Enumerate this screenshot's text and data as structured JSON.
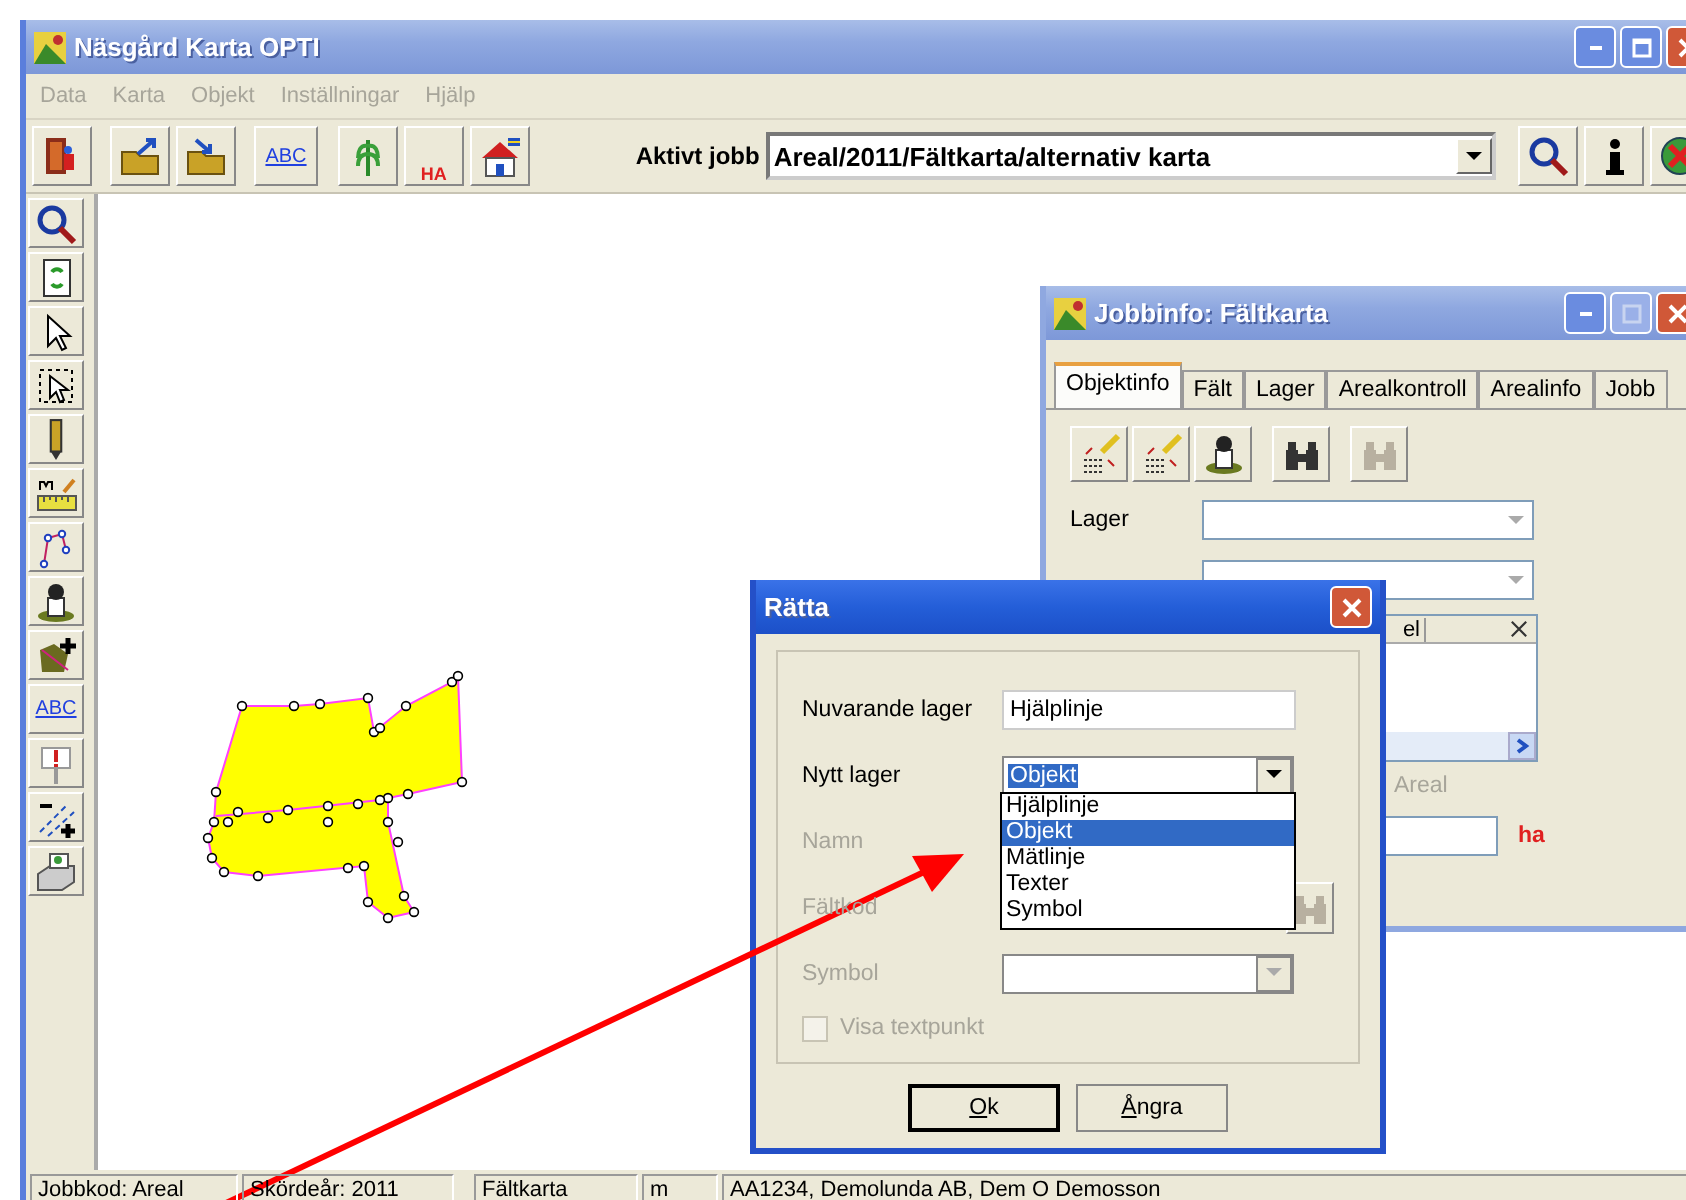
{
  "window": {
    "title": "Näsgård Karta OPTI"
  },
  "menu": [
    "Data",
    "Karta",
    "Objekt",
    "Inställningar",
    "Hjälp"
  ],
  "toolbar": {
    "abc_label": "ABC",
    "ha_label": "HA",
    "active_job_label": "Aktivt jobb",
    "active_job": "Areal/2011/Fältkarta/alternativ karta"
  },
  "side_toolbar": {
    "abc_label": "ABC"
  },
  "jobbinfo": {
    "title": "Jobbinfo: Fältkarta",
    "tabs": [
      {
        "label": "Objektinfo",
        "selected": true
      },
      {
        "label": "Fält",
        "selected": false
      },
      {
        "label": "Lager",
        "selected": false
      },
      {
        "label": "Arealkontroll",
        "selected": false
      },
      {
        "label": "Arealinfo",
        "selected": false
      },
      {
        "label": "Jobb",
        "selected": false
      }
    ],
    "lager_label": "Lager",
    "column_header": "el",
    "areal_label": "Areal",
    "unit": "ha"
  },
  "ratta": {
    "title": "Rätta",
    "fields": [
      {
        "label": "Nuvarande lager",
        "kind": "text",
        "value": "Hjälplinje",
        "disabled": false
      },
      {
        "label": "Nytt lager",
        "kind": "select",
        "value": "Objekt",
        "disabled": false
      },
      {
        "label": "Namn",
        "kind": "hidden",
        "disabled": true
      },
      {
        "label": "Fältkod",
        "kind": "search",
        "disabled": true
      },
      {
        "label": "Symbol",
        "kind": "select",
        "disabled": true
      }
    ],
    "options": [
      {
        "label": "Hjälplinje",
        "selected": false
      },
      {
        "label": "Objekt",
        "selected": true
      },
      {
        "label": "Mätlinje",
        "selected": false
      },
      {
        "label": "Texter",
        "selected": false
      },
      {
        "label": "Symbol",
        "selected": false
      }
    ],
    "checkbox": {
      "label": "Visa textpunkt",
      "checked": false,
      "disabled": true
    },
    "buttons": [
      "Ok",
      "Ångra"
    ]
  },
  "status_bar": [
    "Jobbkod: Areal",
    "Skördeår: 2011",
    "Fältkarta",
    "m",
    "AA1234, Demolunda AB, Dem O Demosson"
  ]
}
